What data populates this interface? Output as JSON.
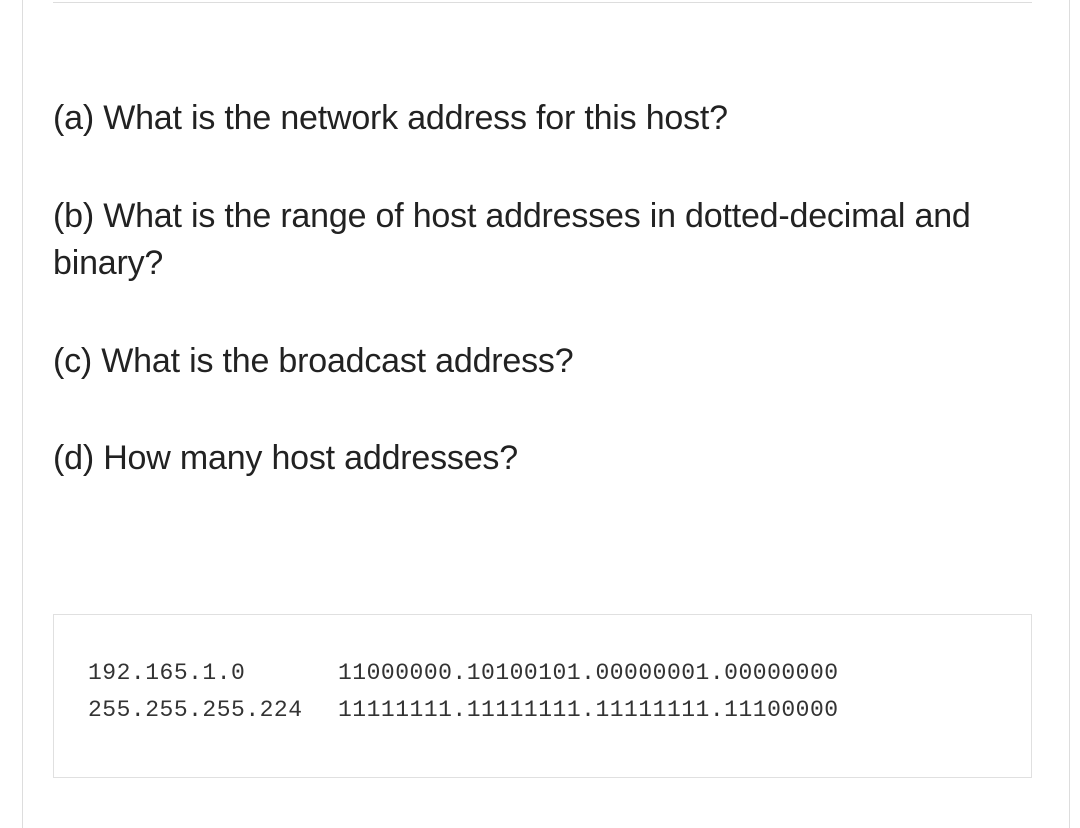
{
  "questions": {
    "a": "(a) What is the network address for this host?",
    "b": "(b) What is the range of host addresses in dotted-decimal and binary?",
    "c": "(c) What is the broadcast address?",
    "d": "(d) How many host addresses?"
  },
  "code": {
    "row1_left": "192.165.1.0",
    "row1_right": "11000000.10100101.00000001.00000000",
    "row2_left": "255.255.255.224",
    "row2_right": "11111111.11111111.11111111.11100000"
  }
}
